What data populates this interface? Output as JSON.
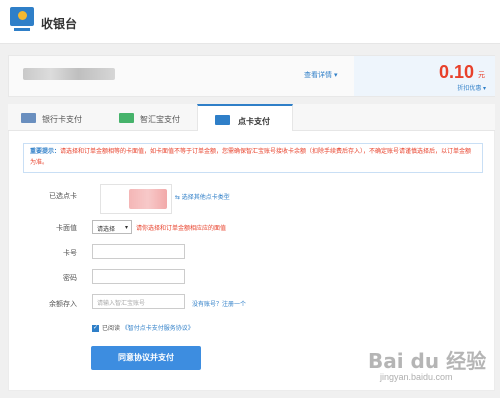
{
  "header": {
    "title": "收银台"
  },
  "order": {
    "details_link": "查看详情 ▾",
    "amount": "0.10",
    "currency": "元",
    "discount_link": "折扣优惠 ▾"
  },
  "tabs": [
    {
      "label": "银行卡支付",
      "icon": "bank-card-icon",
      "color": "#6a8fbf"
    },
    {
      "label": "智汇宝支付",
      "icon": "wallet-icon",
      "color": "#46b36b"
    },
    {
      "label": "点卡支付",
      "icon": "prepaid-card-icon",
      "color": "#2f7fc8",
      "active": true
    }
  ],
  "notice": {
    "title": "重要提示：",
    "text": "请选择和订单金额相等的卡面值，如卡面值不等于订单金额，您需确保智汇宝账号接收卡余额（扣除手续费后存入），不确定账号请谨慎选择后，以订单金额为准。"
  },
  "form": {
    "selected_card_label": "已选点卡",
    "switch_card_link": "⇆ 选择其他点卡类型",
    "face_value_label": "卡面值",
    "face_value_selected": "请选择",
    "face_value_hint": "请你选择和订单金额相应应的面值",
    "card_number_label": "卡号",
    "password_label": "密码",
    "balance_label": "余额存入",
    "account_placeholder": "请输入智汇宝账号",
    "register_link": "没有账号？注册一个",
    "agree_prefix": "已阅读",
    "agree_protocol": "《智付点卡支付服务协议》",
    "submit_label": "同意协议并支付"
  },
  "watermark": {
    "main": "Bai du 经验",
    "sub": "jingyan.baidu.com"
  },
  "colors": {
    "accent": "#2f7fc8",
    "price": "#e8402a"
  }
}
